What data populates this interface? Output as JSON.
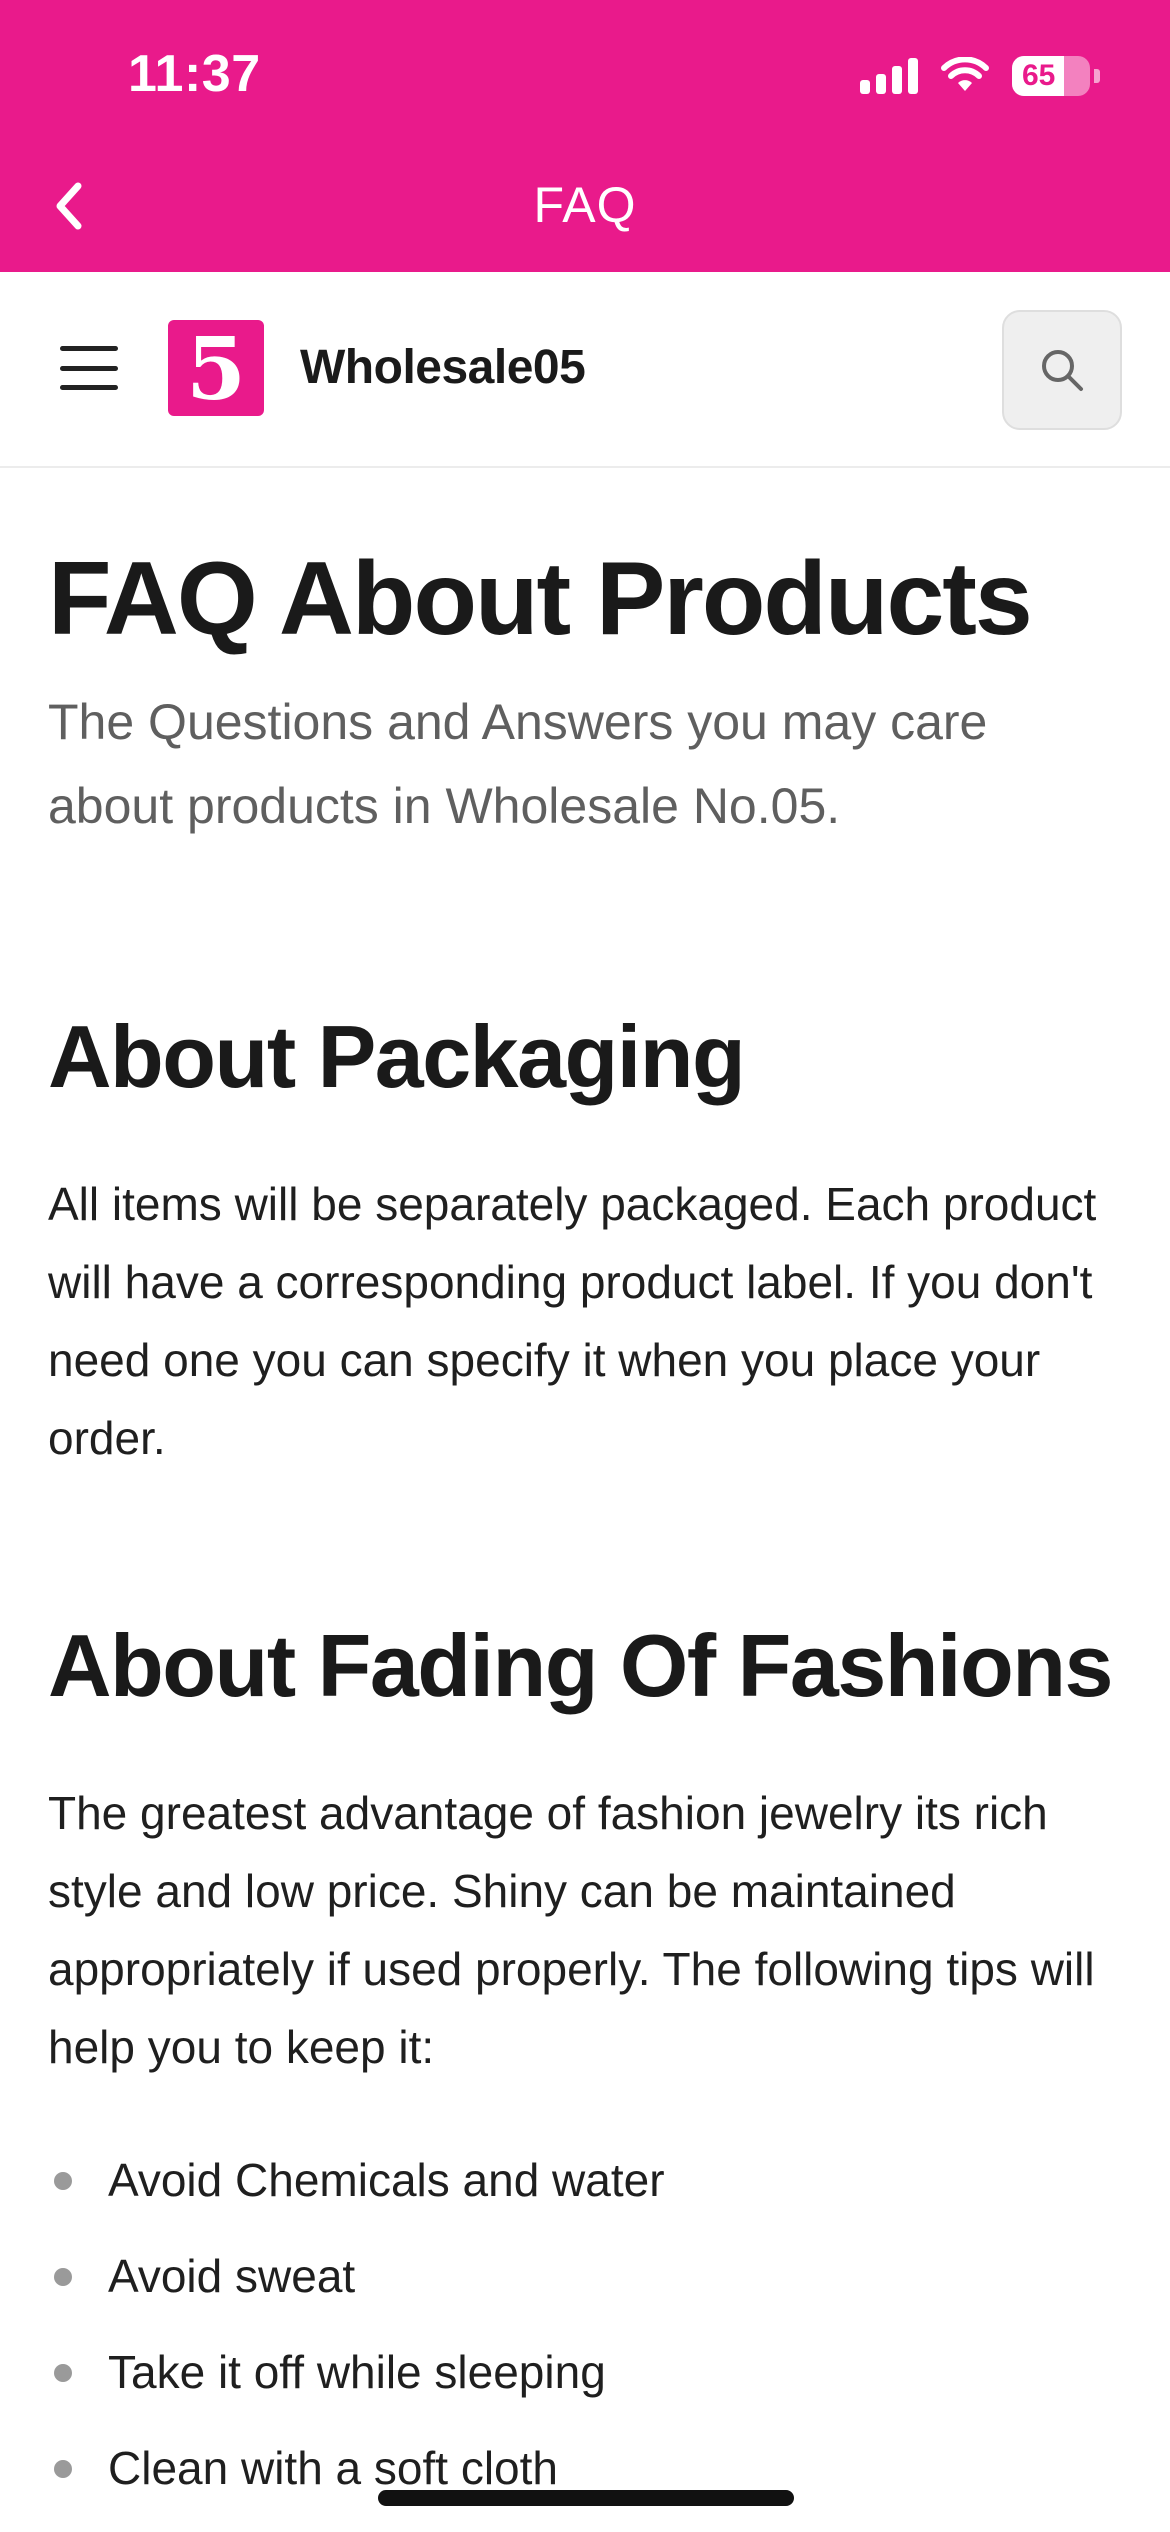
{
  "status_bar": {
    "time": "11:37",
    "battery_percent": "65"
  },
  "nav_bar": {
    "title": "FAQ",
    "back_icon": "chevron-left-icon"
  },
  "site_header": {
    "menu_icon": "hamburger-menu-icon",
    "logo_glyph": "5",
    "site_name": "Wholesale05",
    "search_icon": "search-icon"
  },
  "content": {
    "title": "FAQ About Products",
    "subtitle": "The Questions and Answers you may care about products in Wholesale No.05.",
    "sections": [
      {
        "heading": "About Packaging",
        "body": "All items will be separately packaged. Each product will have a corresponding product label. If you don't need one you can specify it when you place your order."
      },
      {
        "heading": "About Fading Of Fashions",
        "body": "The greatest advantage of fashion jewelry its rich style and low price. Shiny can be maintained appropriately if used properly. The following tips will help you to keep it:",
        "tips": [
          "Avoid Chemicals and water",
          "Avoid sweat",
          "Take it off while sleeping",
          "Clean with a soft cloth"
        ]
      }
    ]
  },
  "colors": {
    "brand_pink": "#E91A8B",
    "text_dark": "#1a1a1a",
    "text_muted": "#5f5f5f"
  }
}
